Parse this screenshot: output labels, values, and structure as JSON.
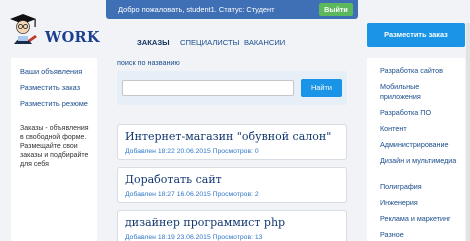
{
  "logo": {
    "text": "WORK",
    "icon": "student-graduation-icon"
  },
  "topbar": {
    "welcome": "Добро пожаловать, student1. Статус: Студент",
    "logout_label": "Выйти"
  },
  "post_order_label": "Разместить заказ",
  "nav": {
    "tabs": [
      {
        "label": "ЗАКАЗЫ",
        "active": true
      },
      {
        "label": "СПЕЦИАЛИСТЫ",
        "active": false
      },
      {
        "label": "ВАКАНСИИ",
        "active": false
      }
    ]
  },
  "left_sidebar": {
    "links": [
      "Ваши объявления",
      "Разместить заказ",
      "Разместить резюме"
    ],
    "description": "Заказы - объявления в свободной форме. Размещайте свои заказы и подбирайте для себя"
  },
  "search": {
    "link_label": "поиск по названию",
    "input_value": "",
    "button_label": "Найти"
  },
  "orders": [
    {
      "title": "Интернет-магазин \"обувной салон\"",
      "meta": "Добавлен 18:22 20.06.2015  Просмотров: 0"
    },
    {
      "title": "Доработать сайт",
      "meta": "Добавлен 18:27 16.06.2015  Просмотров: 2"
    },
    {
      "title": "дизайнер программист php",
      "meta": "Добавлен 18:19 23.06.2015  Просмотров: 13"
    }
  ],
  "categories": [
    "Разработка сайтов",
    "Мобильные приложения",
    "Разработка ПО",
    "Контент",
    "Администрирование",
    "Дизайн и мультимедиа",
    "Полиграфия",
    "Инженерия",
    "Реклама и маркетинг",
    "Разное"
  ],
  "colors": {
    "topbar": "#3f6fb4",
    "accent_button": "#1a94e6",
    "logout_button": "#5cb85c",
    "link": "#1b4d8c",
    "card_title": "#13386f",
    "card_meta": "#2f77c9"
  }
}
